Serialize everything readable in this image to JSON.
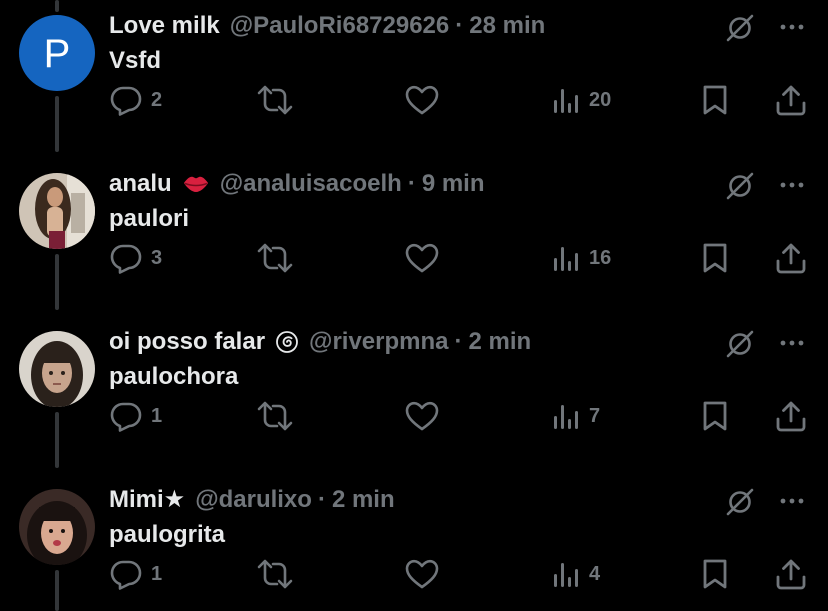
{
  "colors": {
    "background": "#000000",
    "primary_text": "#e7e9ea",
    "secondary_text": "#71767b",
    "thread_line": "#333639",
    "avatar_p_bg": "#1565c0"
  },
  "tweets": [
    {
      "display_name": "Love milk",
      "name_emoji": "",
      "handle": "@PauloRi68729626",
      "separator": "·",
      "time": "28 min",
      "text": "Vsfd",
      "avatar_letter": "P",
      "replies": "2",
      "retweets": "",
      "likes": "",
      "views": "20"
    },
    {
      "display_name": "analu",
      "name_emoji": "lips-emoji",
      "handle": "@analuisacoelh",
      "separator": "·",
      "time": "9 min",
      "text": "paulori",
      "avatar_letter": "",
      "replies": "3",
      "retweets": "",
      "likes": "",
      "views": "16"
    },
    {
      "display_name": "oi posso falar",
      "name_emoji": "spiral-emoji",
      "handle": "@riverpmna",
      "separator": "·",
      "time": "2 min",
      "text": "paulochora",
      "avatar_letter": "",
      "replies": "1",
      "retweets": "",
      "likes": "",
      "views": "7"
    },
    {
      "display_name": "Mimi★",
      "name_emoji": "",
      "handle": "@darulixo",
      "separator": "·",
      "time": "2 min",
      "text": "paulogrita",
      "avatar_letter": "",
      "replies": "1",
      "retweets": "",
      "likes": "",
      "views": "4"
    }
  ]
}
